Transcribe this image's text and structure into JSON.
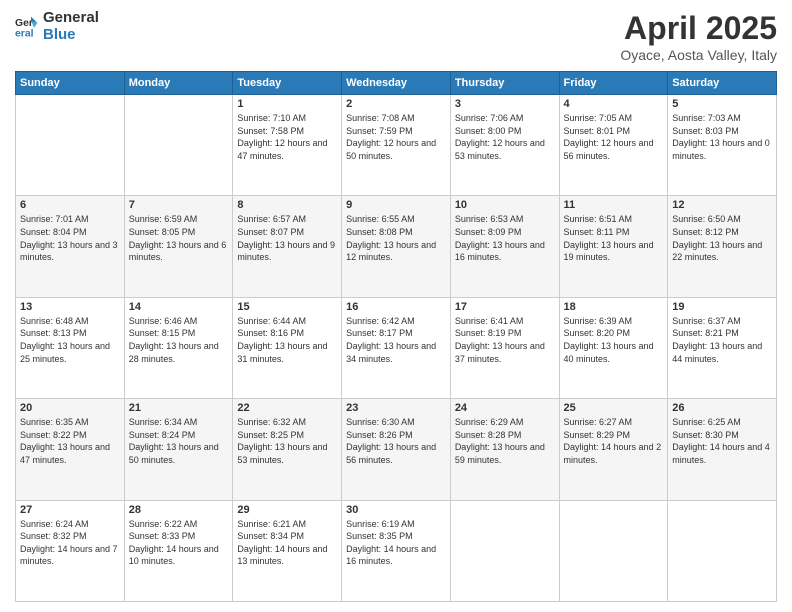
{
  "logo": {
    "line1": "General",
    "line2": "Blue"
  },
  "title": "April 2025",
  "subtitle": "Oyace, Aosta Valley, Italy",
  "days_of_week": [
    "Sunday",
    "Monday",
    "Tuesday",
    "Wednesday",
    "Thursday",
    "Friday",
    "Saturday"
  ],
  "weeks": [
    [
      {
        "day": "",
        "info": ""
      },
      {
        "day": "",
        "info": ""
      },
      {
        "day": "1",
        "info": "Sunrise: 7:10 AM\nSunset: 7:58 PM\nDaylight: 12 hours and 47 minutes."
      },
      {
        "day": "2",
        "info": "Sunrise: 7:08 AM\nSunset: 7:59 PM\nDaylight: 12 hours and 50 minutes."
      },
      {
        "day": "3",
        "info": "Sunrise: 7:06 AM\nSunset: 8:00 PM\nDaylight: 12 hours and 53 minutes."
      },
      {
        "day": "4",
        "info": "Sunrise: 7:05 AM\nSunset: 8:01 PM\nDaylight: 12 hours and 56 minutes."
      },
      {
        "day": "5",
        "info": "Sunrise: 7:03 AM\nSunset: 8:03 PM\nDaylight: 13 hours and 0 minutes."
      }
    ],
    [
      {
        "day": "6",
        "info": "Sunrise: 7:01 AM\nSunset: 8:04 PM\nDaylight: 13 hours and 3 minutes."
      },
      {
        "day": "7",
        "info": "Sunrise: 6:59 AM\nSunset: 8:05 PM\nDaylight: 13 hours and 6 minutes."
      },
      {
        "day": "8",
        "info": "Sunrise: 6:57 AM\nSunset: 8:07 PM\nDaylight: 13 hours and 9 minutes."
      },
      {
        "day": "9",
        "info": "Sunrise: 6:55 AM\nSunset: 8:08 PM\nDaylight: 13 hours and 12 minutes."
      },
      {
        "day": "10",
        "info": "Sunrise: 6:53 AM\nSunset: 8:09 PM\nDaylight: 13 hours and 16 minutes."
      },
      {
        "day": "11",
        "info": "Sunrise: 6:51 AM\nSunset: 8:11 PM\nDaylight: 13 hours and 19 minutes."
      },
      {
        "day": "12",
        "info": "Sunrise: 6:50 AM\nSunset: 8:12 PM\nDaylight: 13 hours and 22 minutes."
      }
    ],
    [
      {
        "day": "13",
        "info": "Sunrise: 6:48 AM\nSunset: 8:13 PM\nDaylight: 13 hours and 25 minutes."
      },
      {
        "day": "14",
        "info": "Sunrise: 6:46 AM\nSunset: 8:15 PM\nDaylight: 13 hours and 28 minutes."
      },
      {
        "day": "15",
        "info": "Sunrise: 6:44 AM\nSunset: 8:16 PM\nDaylight: 13 hours and 31 minutes."
      },
      {
        "day": "16",
        "info": "Sunrise: 6:42 AM\nSunset: 8:17 PM\nDaylight: 13 hours and 34 minutes."
      },
      {
        "day": "17",
        "info": "Sunrise: 6:41 AM\nSunset: 8:19 PM\nDaylight: 13 hours and 37 minutes."
      },
      {
        "day": "18",
        "info": "Sunrise: 6:39 AM\nSunset: 8:20 PM\nDaylight: 13 hours and 40 minutes."
      },
      {
        "day": "19",
        "info": "Sunrise: 6:37 AM\nSunset: 8:21 PM\nDaylight: 13 hours and 44 minutes."
      }
    ],
    [
      {
        "day": "20",
        "info": "Sunrise: 6:35 AM\nSunset: 8:22 PM\nDaylight: 13 hours and 47 minutes."
      },
      {
        "day": "21",
        "info": "Sunrise: 6:34 AM\nSunset: 8:24 PM\nDaylight: 13 hours and 50 minutes."
      },
      {
        "day": "22",
        "info": "Sunrise: 6:32 AM\nSunset: 8:25 PM\nDaylight: 13 hours and 53 minutes."
      },
      {
        "day": "23",
        "info": "Sunrise: 6:30 AM\nSunset: 8:26 PM\nDaylight: 13 hours and 56 minutes."
      },
      {
        "day": "24",
        "info": "Sunrise: 6:29 AM\nSunset: 8:28 PM\nDaylight: 13 hours and 59 minutes."
      },
      {
        "day": "25",
        "info": "Sunrise: 6:27 AM\nSunset: 8:29 PM\nDaylight: 14 hours and 2 minutes."
      },
      {
        "day": "26",
        "info": "Sunrise: 6:25 AM\nSunset: 8:30 PM\nDaylight: 14 hours and 4 minutes."
      }
    ],
    [
      {
        "day": "27",
        "info": "Sunrise: 6:24 AM\nSunset: 8:32 PM\nDaylight: 14 hours and 7 minutes."
      },
      {
        "day": "28",
        "info": "Sunrise: 6:22 AM\nSunset: 8:33 PM\nDaylight: 14 hours and 10 minutes."
      },
      {
        "day": "29",
        "info": "Sunrise: 6:21 AM\nSunset: 8:34 PM\nDaylight: 14 hours and 13 minutes."
      },
      {
        "day": "30",
        "info": "Sunrise: 6:19 AM\nSunset: 8:35 PM\nDaylight: 14 hours and 16 minutes."
      },
      {
        "day": "",
        "info": ""
      },
      {
        "day": "",
        "info": ""
      },
      {
        "day": "",
        "info": ""
      }
    ]
  ]
}
